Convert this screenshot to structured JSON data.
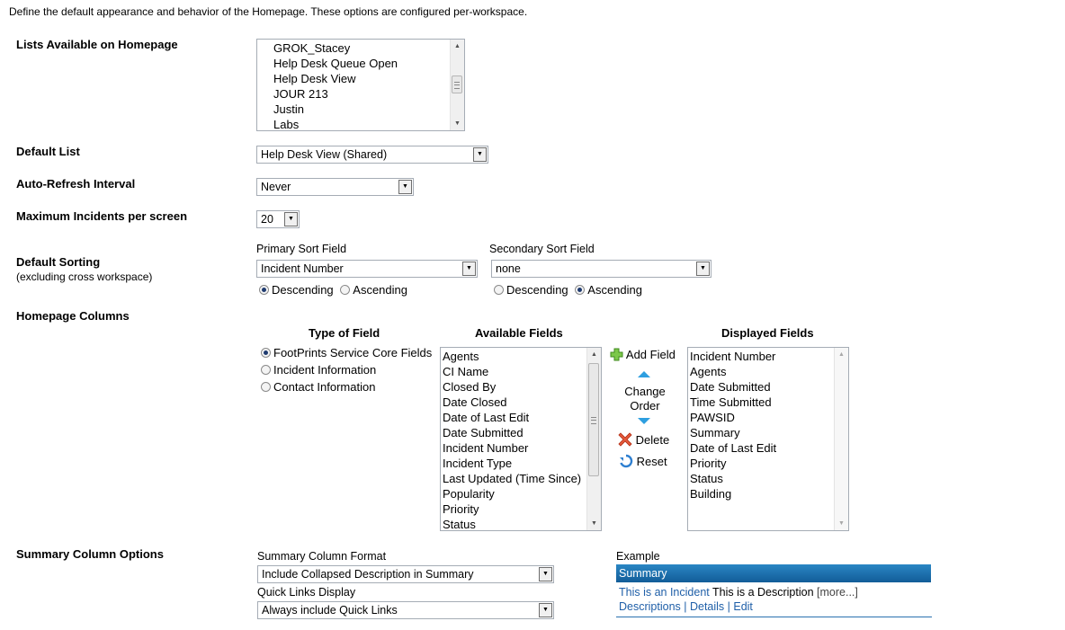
{
  "intro": "Define the default appearance and behavior of the Homepage. These options are configured per-workspace.",
  "lists": {
    "label": "Lists Available on Homepage",
    "items": [
      "GROK_Stacey",
      "Help Desk Queue Open",
      "Help Desk View",
      "JOUR 213",
      "Justin",
      "Labs"
    ]
  },
  "default_list": {
    "label": "Default List",
    "value": "Help Desk View (Shared)"
  },
  "auto_refresh": {
    "label": "Auto-Refresh Interval",
    "value": "Never"
  },
  "max_incidents": {
    "label": "Maximum Incidents per screen",
    "value": "20"
  },
  "sorting": {
    "label": "Default Sorting",
    "sublabel": "(excluding cross workspace)",
    "primary_label": "Primary Sort Field",
    "primary_value": "Incident Number",
    "secondary_label": "Secondary Sort Field",
    "secondary_value": "none",
    "descending": "Descending",
    "ascending": "Ascending",
    "primary_order": "Descending",
    "secondary_order": "Ascending"
  },
  "columns": {
    "label": "Homepage Columns",
    "type_head": "Type of Field",
    "available_head": "Available Fields",
    "displayed_head": "Displayed Fields",
    "types": [
      "FootPrints Service Core Fields",
      "Incident Information",
      "Contact Information"
    ],
    "available": [
      "Agents",
      "CI Name",
      "Closed By",
      "Date Closed",
      "Date of Last Edit",
      "Date Submitted",
      "Incident Number",
      "Incident Type",
      "Last Updated (Time Since)",
      "Popularity",
      "Priority",
      "Status"
    ],
    "displayed": [
      "Incident Number",
      "Agents",
      "Date Submitted",
      "Time Submitted",
      "PAWSID",
      "Summary",
      "Date of Last Edit",
      "Priority",
      "Status",
      "Building"
    ],
    "add_field": "Add Field",
    "change_order_1": "Change",
    "change_order_2": "Order",
    "delete": "Delete",
    "reset": "Reset"
  },
  "summary": {
    "label": "Summary Column Options",
    "format_label": "Summary Column Format",
    "format_value": "Include Collapsed Description in Summary",
    "quicklinks_label": "Quick Links Display",
    "quicklinks_value": "Always include Quick Links",
    "example_label": "Example",
    "example_header": "Summary",
    "example_incident": "This is an Incident",
    "example_desc": "This is a Description",
    "example_more": "[more...]",
    "example_links": "Descriptions | Details | Edit"
  },
  "colors": {
    "accent_blue": "#1f5fa8",
    "header_bar": "#1b6ea8",
    "arrow_blue": "#2e9fe0"
  }
}
